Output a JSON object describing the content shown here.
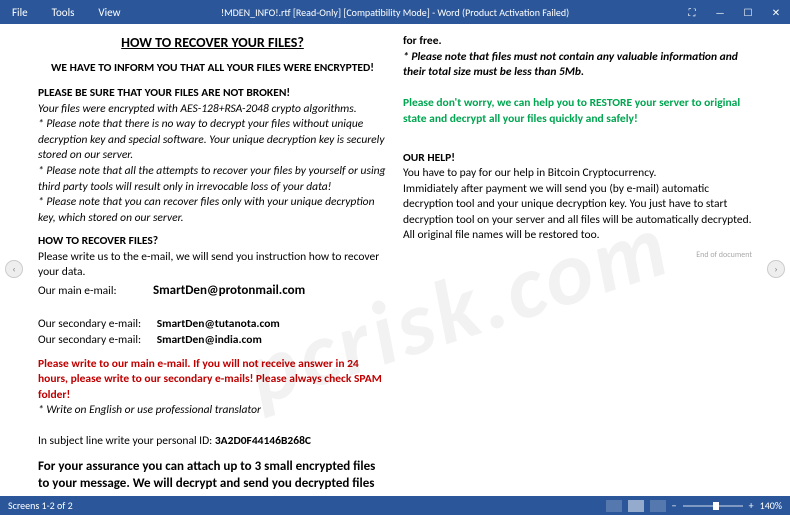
{
  "titlebar": {
    "menu": {
      "file": "File",
      "tools": "Tools",
      "view": "View"
    },
    "title": "!MDEN_INFO!.rtf [Read-Only] [Compatibility Mode] - Word (Product Activation Failed)",
    "controls": {
      "reading": "⛶",
      "min": "—",
      "max": "☐",
      "close": "✕"
    }
  },
  "doc": {
    "title": "HOW TO RECOVER YOUR FILES?",
    "informLine": "WE HAVE TO INFORM YOU THAT ALL YOUR FILES WERE ENCRYPTED!",
    "beSureHead": "PLEASE BE SURE THAT YOUR FILES ARE NOT BROKEN!",
    "encAlgo": "Your files were encrypted with AES-128+RSA-2048 crypto algorithms.",
    "note1": "* Please note that there is no way to decrypt your files without unique decryption key and special software. Your unique decryption key is securely stored on our server.",
    "note2": "* Please note that all the attempts to recover your files by yourself or using third party tools will result only in irrevocable loss of your data!",
    "note3": "* Please note that you can recover files only with your unique decryption key, which stored on our server.",
    "howHead": "HOW TO RECOVER FILES?",
    "writeUs": "Please write us to the e-mail, we will send you instruction how to recover your data.",
    "mainEmailLabel": "Our main e-mail:",
    "mainEmail": "SmartDen@protonmail.com",
    "secEmailLabel1": "Our secondary e-mail:",
    "secEmail1": "SmartDen@tutanota.com",
    "secEmailLabel2": "Our secondary e-mail:",
    "secEmail2": "SmartDen@india.com",
    "redWarn": "Please write to our main e-mail. If you will not receive answer in 24 hours, please write to our secondary e-mails! Please always check SPAM folder!",
    "transNote": "* Write on English or use professional translator",
    "subjLabel": "In subject line write your personal ID: ",
    "personalId": "3A2D0F44146B268C",
    "assurance": "For your assurance you can attach up to 3 small encrypted files to your message. We will decrypt and send you decrypted files",
    "forFree": "for free.",
    "noteValuable": "*       Please note that files must not contain any valuable information and their total size must be less than 5Mb.",
    "greenHelp": "Please don't worry, we can help you to RESTORE your server to original state and decrypt all your files quickly and safely!",
    "ourHelpHead": "OUR HELP!",
    "payBitcoin": "You have to pay for our help in Bitcoin Cryptocurrency.",
    "afterPay": "Immidiately after payment we will send you (by e-mail) automatic decryption tool and your unique decryption key. You just have to start decryption tool on your server and all files will be automatically decrypted. All original file names will be restored too.",
    "endDoc": "End of document"
  },
  "statusbar": {
    "screens": "Screens 1-2 of 2",
    "zoom": "140%"
  },
  "watermark": "pcrisk.com",
  "nav": {
    "left": "‹",
    "right": "›"
  }
}
